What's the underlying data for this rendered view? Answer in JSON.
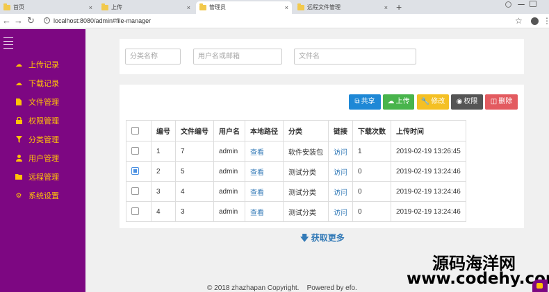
{
  "browser": {
    "tabs": [
      {
        "label": "首页",
        "active": false
      },
      {
        "label": "上传",
        "active": false
      },
      {
        "label": "管理员",
        "active": true
      },
      {
        "label": "远程文件管理",
        "active": false
      }
    ],
    "close_glyph": "×",
    "new_tab_glyph": "+",
    "url": "localhost:8080/admin#file-manager",
    "info_glyph": "i"
  },
  "sidebar": {
    "items": [
      {
        "label": "上传记录",
        "icon": "cloud-upload-icon"
      },
      {
        "label": "下载记录",
        "icon": "cloud-download-icon"
      },
      {
        "label": "文件管理",
        "icon": "file-icon"
      },
      {
        "label": "权限管理",
        "icon": "lock-icon"
      },
      {
        "label": "分类管理",
        "icon": "filter-icon"
      },
      {
        "label": "用户管理",
        "icon": "user-icon"
      },
      {
        "label": "远程管理",
        "icon": "folder-icon"
      },
      {
        "label": "系统设置",
        "icon": "gear-icon"
      }
    ],
    "accent": "#ffc107",
    "background": "#7d0782"
  },
  "filters": {
    "category_placeholder": "分类名称",
    "user_placeholder": "用户名或邮箱",
    "filename_placeholder": "文件名"
  },
  "toolbar": {
    "share_label": "共享",
    "upload_label": "上传",
    "edit_label": "修改",
    "permission_label": "权限",
    "delete_label": "删除"
  },
  "table": {
    "headers": [
      "编号",
      "文件编号",
      "用户名",
      "本地路径",
      "分类",
      "链接",
      "下载次数",
      "上传时间"
    ],
    "rows": [
      {
        "checked": false,
        "id": "1",
        "file_id": "7",
        "user": "admin",
        "path": "查看",
        "category": "软件安装包",
        "link": "访问",
        "downloads": "1",
        "time": "2019-02-19 13:26:45"
      },
      {
        "checked": true,
        "id": "2",
        "file_id": "5",
        "user": "admin",
        "path": "查看",
        "category": "测试分类",
        "link": "访问",
        "downloads": "0",
        "time": "2019-02-19 13:24:46"
      },
      {
        "checked": false,
        "id": "3",
        "file_id": "4",
        "user": "admin",
        "path": "查看",
        "category": "测试分类",
        "link": "访问",
        "downloads": "0",
        "time": "2019-02-19 13:24:46"
      },
      {
        "checked": false,
        "id": "4",
        "file_id": "3",
        "user": "admin",
        "path": "查看",
        "category": "测试分类",
        "link": "访问",
        "downloads": "0",
        "time": "2019-02-19 13:24:46"
      }
    ]
  },
  "load_more": "获取更多",
  "footer": "© 2018 zhazhapan Copyright.    Powered by efo.",
  "watermark": {
    "line1": "源码海洋网",
    "line2": "www.codehy.com"
  }
}
